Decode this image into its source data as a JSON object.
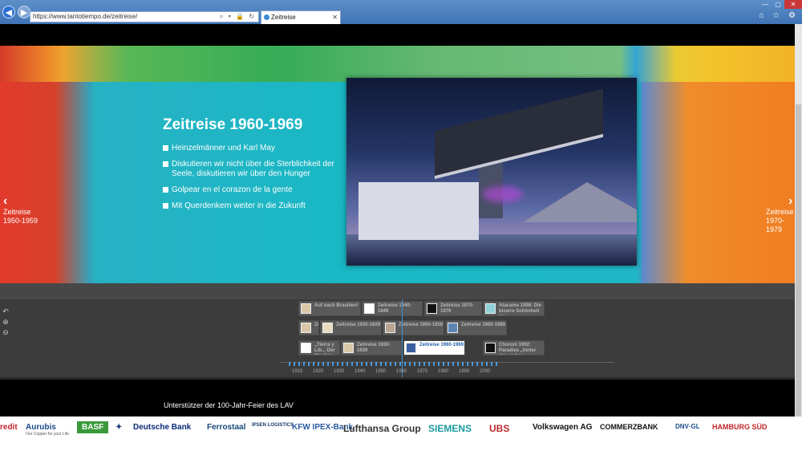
{
  "browser": {
    "url": "https://www.tantotiempo.de/zeitreise/",
    "tab_title": "Zeitreise",
    "close_tab": "✕",
    "win_min": "—",
    "win_max": "▢",
    "win_close": "✕",
    "right_icons": "⌂ ☆ ⚙",
    "address_tools": "⌕ ▾ 🔒 ↻",
    "scroll_up": "▲",
    "scroll_down": "▼"
  },
  "hero": {
    "title": "Zeitreise 1960-1969",
    "bullets": [
      "Heinzelmänner und Karl May",
      "Diskutieren wir nicht über die Sterblichkeit der Seele, diskutieren wir über den Hunger",
      "Golpear en el corazon de la gente",
      "Mit Querdenkern weiter in die Zukunft"
    ],
    "prev_arrow": "‹",
    "next_arrow": "›",
    "prev_label": "Zeitreise\n1950-1959",
    "next_label": "Zeitreise\n1970-1979"
  },
  "timeline": {
    "controls": [
      "↶",
      "⊕",
      "⊖"
    ],
    "events": [
      {
        "label": "Auf nach Brasilien!"
      },
      {
        "label": "Zeitreise 1940-1949"
      },
      {
        "label": "Zeitreise 1970-1979"
      },
      {
        "label": "Atacama 1998: Die bizarre Schönheit der"
      },
      {
        "label": "Zu"
      },
      {
        "label": "Zeitreise 1920-1929"
      },
      {
        "label": "Zeitreise 1950-1959"
      },
      {
        "label": "Zeitreise 1980-1989"
      },
      {
        "label": "„Tierra y Lib... Der Mexikan... Revolutionär"
      },
      {
        "label": "Zeitreise 1930-1939"
      },
      {
        "label": "Zeitreise 1960-1969"
      },
      {
        "label": "Choroní 1992: Paradies „hinter den sieben Bergen“"
      }
    ],
    "years": [
      "1910",
      "1920",
      "1930",
      "1940",
      "1950",
      "1960",
      "1970",
      "1980",
      "1990",
      "2000"
    ]
  },
  "sponsors": {
    "title": "Unterstützer der 100-Jahr-Feier des LAV",
    "logos": [
      {
        "name": "redit"
      },
      {
        "name": "Aurubis",
        "tagline": "Our Copper for your Life"
      },
      {
        "name": "BASF"
      },
      {
        "name": "✦"
      },
      {
        "name": "Deutsche Bank"
      },
      {
        "name": "Ferrostaal"
      },
      {
        "name": "IPSEN LOGISTICS"
      },
      {
        "name": "KFW IPEX-Bank"
      },
      {
        "name": "Lufthansa Group"
      },
      {
        "name": "SIEMENS"
      },
      {
        "name": "UBS"
      },
      {
        "name": "Volkswagen AG"
      },
      {
        "name": "COMMERZBANK"
      },
      {
        "name": "DNV·GL"
      },
      {
        "name": "HAMBURG SÜD"
      }
    ]
  }
}
